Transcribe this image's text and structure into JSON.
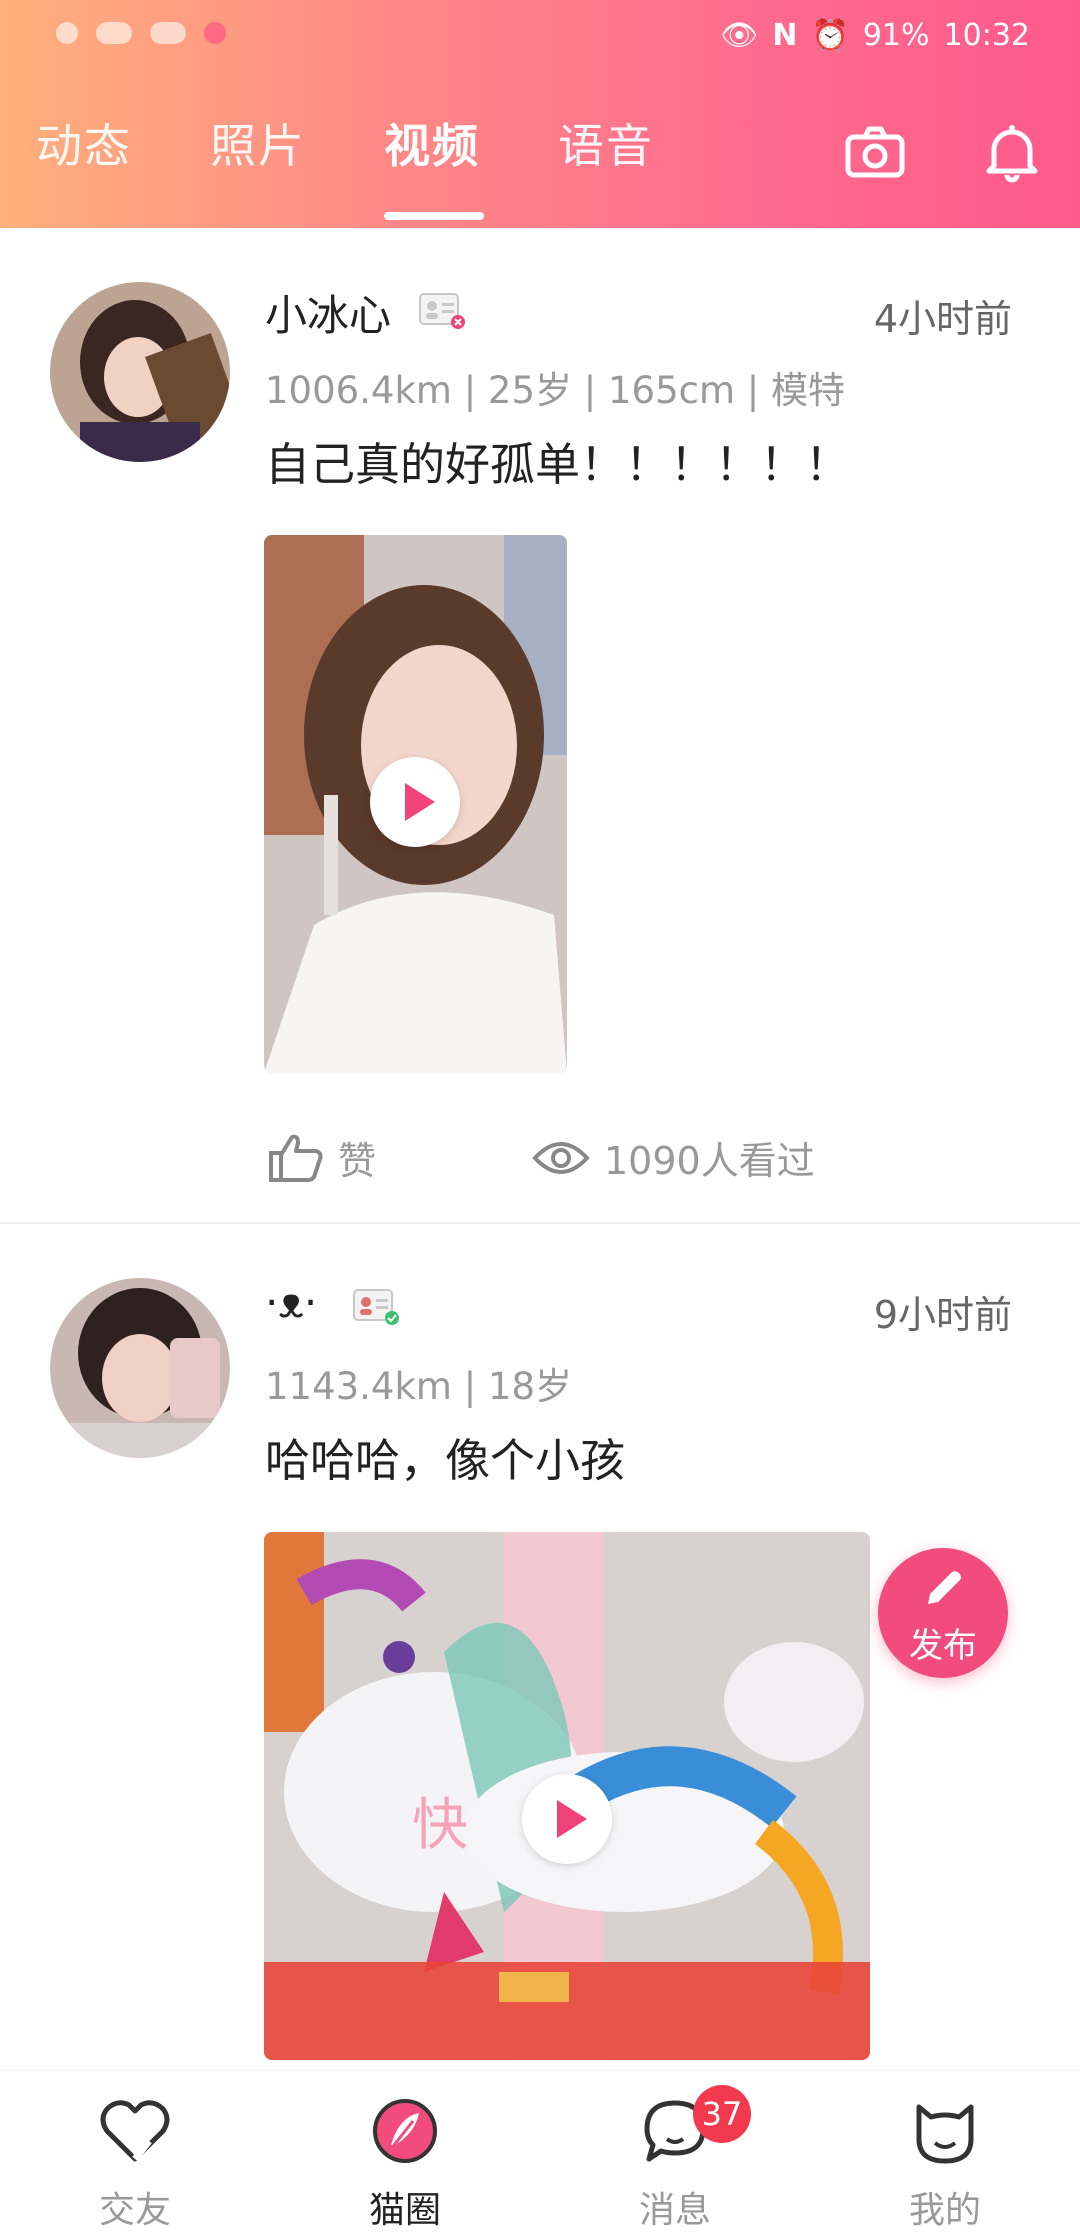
{
  "status_bar": {
    "battery": "91%",
    "time": "10:32",
    "icons": [
      "eye-icon",
      "nfc-icon",
      "alarm-icon"
    ]
  },
  "tabs": [
    {
      "label": "动态",
      "active": false
    },
    {
      "label": "照片",
      "active": false
    },
    {
      "label": "视频",
      "active": true
    },
    {
      "label": "语音",
      "active": false
    }
  ],
  "header_icons": [
    "camera-icon",
    "bell-icon"
  ],
  "posts": [
    {
      "username": "小冰心",
      "verified": false,
      "time": "4小时前",
      "meta": "1006.4km | 25岁 | 165cm | 模特",
      "text": "自己真的好孤单！！！！！！",
      "like_label": "赞",
      "views_label": "1090人看过"
    },
    {
      "username": "·ᴥ·",
      "verified": true,
      "time": "9小时前",
      "meta": "1143.4km | 18岁",
      "text": "哈哈哈，像个小孩",
      "video_overlay_text": "快"
    }
  ],
  "fab": {
    "label": "发布"
  },
  "bottom_nav": [
    {
      "label": "交友",
      "icon": "heart-icon",
      "active": false
    },
    {
      "label": "猫圈",
      "icon": "feather-circle-icon",
      "active": true
    },
    {
      "label": "消息",
      "icon": "chat-bubble-icon",
      "active": false,
      "badge": "37"
    },
    {
      "label": "我的",
      "icon": "cat-face-icon",
      "active": false
    }
  ],
  "colors": {
    "accent": "#f24c7e",
    "header_start": "#ffb07c",
    "header_end": "#ff5a8c",
    "badge": "#f2394e"
  }
}
